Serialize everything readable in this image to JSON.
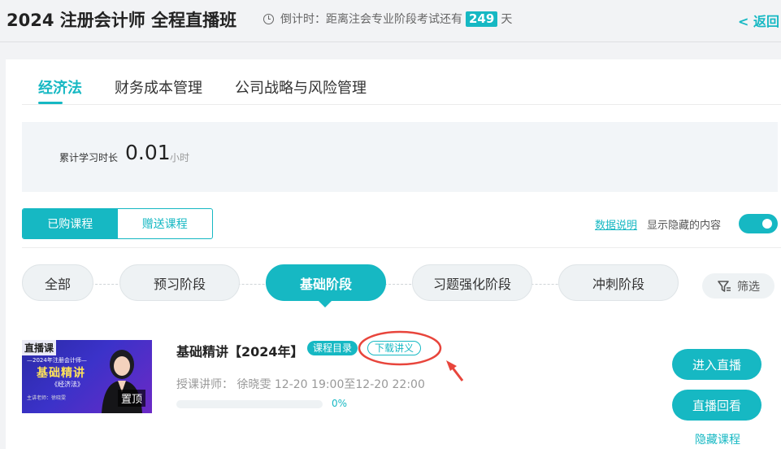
{
  "header": {
    "title": "2024 注册会计师 全程直播班",
    "countdown_prefix": "倒计时：距离注会专业阶段考试还有",
    "countdown_days": "249",
    "countdown_suffix": "天",
    "back_label": "< 返回"
  },
  "subject_tabs": [
    {
      "label": "经济法",
      "active": true
    },
    {
      "label": "财务成本管理",
      "active": false
    },
    {
      "label": "公司战略与风险管理",
      "active": false
    }
  ],
  "stats": {
    "label": "累计学习时长",
    "value": "0.01",
    "unit": "小时"
  },
  "course_toggle": {
    "purchased": "已购课程",
    "gifted": "赠送课程",
    "active": "purchased"
  },
  "data_note_label": "数据说明",
  "show_hidden_label": "显示隐藏的内容",
  "show_hidden_on": true,
  "stages": [
    {
      "label": "全部",
      "active": false
    },
    {
      "label": "预习阶段",
      "active": false
    },
    {
      "label": "基础阶段",
      "active": true
    },
    {
      "label": "习题强化阶段",
      "active": false
    },
    {
      "label": "冲刺阶段",
      "active": false
    }
  ],
  "filter_label": "筛选",
  "course": {
    "thumbnail": {
      "tag": "直播课",
      "subtitle": "—2024年注册会计师—",
      "main": "基础精讲",
      "note": "《经济法》",
      "caption": "主讲老师：徐晓雯",
      "pin": "置顶"
    },
    "name": "基础精讲【2024年】",
    "catalog_label": "课程目录",
    "download_label": "下载讲义",
    "teacher_line": "授课讲师：  徐晓雯 12-20 19:00至12-20 22:00",
    "progress_text": "0%",
    "progress_fraction": 0,
    "enter_live_label": "进入直播",
    "replay_label": "直播回看",
    "hide_label": "隐藏课程"
  },
  "colors": {
    "accent": "#16b8c3",
    "annotation": "#e8453c"
  }
}
